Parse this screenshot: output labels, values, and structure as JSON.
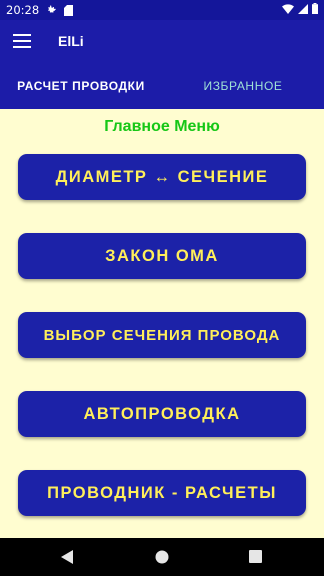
{
  "status_bar": {
    "time": "20:28",
    "icons_left": [
      "gear-icon",
      "sd-card-icon"
    ],
    "icons_right": [
      "wifi-icon",
      "signal-icon",
      "battery-icon"
    ]
  },
  "app_bar": {
    "title": "ElLi",
    "menu_icon": "hamburger-icon"
  },
  "tabs": [
    {
      "label": "РАСЧЕТ ПРОВОДКИ",
      "active": true
    },
    {
      "label": "ИЗБРАННОЕ",
      "active": false
    }
  ],
  "main": {
    "heading": "Главное Меню",
    "buttons": [
      {
        "label": "ДИАМЕТР ↔ СЕЧЕНИЕ"
      },
      {
        "label": "ЗАКОН ОМА"
      },
      {
        "label": "ВЫБОР СЕЧЕНИЯ ПРОВОДА"
      },
      {
        "label": "АВТОПРОВОДКА"
      },
      {
        "label": "ПРОВОДНИК - РАСЧЕТЫ"
      }
    ]
  },
  "nav_bar": {
    "icons": [
      "back-icon",
      "home-icon",
      "recents-icon"
    ]
  },
  "colors": {
    "primary": "#1c1ca8",
    "background": "#fffdd0",
    "heading": "#16c716",
    "button_text": "#ffef5a",
    "tab_inactive": "#9fe0d6"
  }
}
